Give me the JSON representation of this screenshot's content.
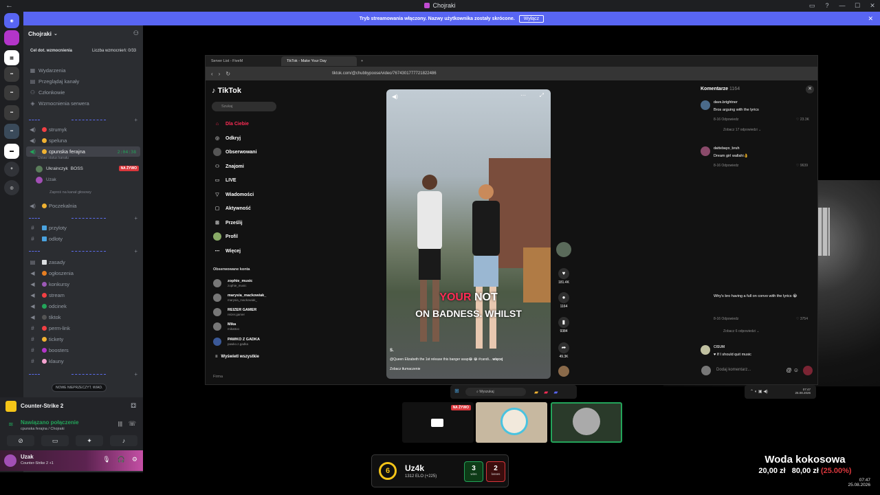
{
  "window": {
    "title": "Chojraki",
    "back": "←",
    "controls": [
      "▭",
      "?",
      "—",
      "☐",
      "✕"
    ]
  },
  "banner": {
    "text": "Tryb streamowania włączony. Nazwy użytkownika zostały skrócone.",
    "button": "Wyłącz",
    "close": "✕"
  },
  "server": {
    "name": "Chojraki",
    "boost_goal": "Cel dot. wzmocnienia",
    "boost_count": "Liczba wzmocnień: 0/33",
    "nav": [
      "Wydarzenia",
      "Przeglądaj kanały",
      "Członkowie",
      "Wzmocnienia serwera"
    ]
  },
  "channels": {
    "voice1": "strumyk",
    "voice2": "speluna",
    "voice3": "cpunska ferajna",
    "voice3_timer": "2:04:38",
    "voice3_status": "Ustaw status kanału",
    "member1": "Ukrainczyk",
    "member1_tag": "BOSS",
    "live": "NA ŻYWO",
    "member2": "Uzak",
    "invite": "Zaproś na kanał głosowy",
    "waiting": "Poczekalnia",
    "text1": "przyloty",
    "text2": "odloty",
    "info": [
      "zasady",
      "ogłoszenia",
      "konkursy",
      "stream",
      "odcinek",
      "tiktok",
      "perm-link",
      "tickety",
      "boosters",
      "klauny"
    ],
    "tooltip": "NOWE NIEPRZECZYT. WIAD."
  },
  "voice_panel": {
    "game": "Counter-Strike 2",
    "connected": "Nawiązano połączenie",
    "channel": "cpunska ferajna / Chojraki",
    "buttons": [
      "⊘",
      "▭",
      "✦",
      "♪"
    ]
  },
  "user_panel": {
    "name": "Uzak",
    "status": "Counter-Strike 2 +1",
    "controls": [
      "🎙",
      "🎧",
      "⚙"
    ]
  },
  "browser": {
    "tabs": [
      "Server List - FiveM",
      "TikTok - Make Your Day"
    ],
    "url": "tiktok.com/@chubbypoose/video/7674301777721822486"
  },
  "tiktok": {
    "logo": "TikTok",
    "search": "Szukaj",
    "nav": [
      "Dla Ciebie",
      "Odkryj",
      "Obserwowani",
      "Znajomi",
      "LIVE",
      "Wiadomości",
      "Aktywność",
      "Prześlij",
      "Profil",
      "Więcej"
    ],
    "followed_header": "Obserwowane konta",
    "accounts": [
      {
        "name": "zophie_music",
        "handle": "zophie_music"
      },
      {
        "name": "marysia_mackowiak_",
        "handle": "marysia_mackowiak_"
      },
      {
        "name": "REIZER GAMER",
        "handle": "reizer.gamer"
      },
      {
        "name": "Mika",
        "handle": "mikattoo"
      },
      {
        "name": "PAWKO Z GADKA",
        "handle": "pawko.z.gadka"
      }
    ],
    "show_all": "Wyświetl wszystkie",
    "company": "Firma",
    "caption_red": "YOUR",
    "caption_white": "NOT",
    "caption_line2": "ON BADNESS. WHILST",
    "video_user": "S.",
    "video_desc": "@Queen Elizabeth the 1st release this banger asap😂 😂 #candi...",
    "video_more": "więcej",
    "translation": "Zobacz tłumaczenie",
    "likes": "181.4K",
    "comments": "1164",
    "saves": "9384",
    "shares": "49.3K"
  },
  "comments": {
    "title": "Komentarze",
    "count": "1164",
    "items": [
      {
        "user": "dave.brightner",
        "text": "Bros arguing with the lyrics",
        "meta": "8-16   Odpowiedz",
        "likes": "♡ 23.3K",
        "more": "Zobacz 17 odpowiedzi ⌄"
      },
      {
        "user": "dattebayo_bruh",
        "text": "Dream girl wallahi👌",
        "meta": "8-16   Odpowiedz",
        "likes": "♡ 9639"
      },
      {
        "user": "",
        "text": "Why's bro having a full on convo with the lyrics 😭",
        "meta": "8-16   Odpowiedz",
        "likes": "♡ 3754",
        "more": "Zobacz 6 odpowiedzi ⌄"
      },
      {
        "user": "CISUM",
        "text": "♥ If I should quit music"
      }
    ],
    "input": "Dodaj komentarz..."
  },
  "taskbar": {
    "search": "Wyszukaj",
    "time": "07:47",
    "date": "25.08.2026"
  },
  "cs": {
    "level": "6",
    "name": "Uz4k",
    "elo": "1312 ELO (+225)",
    "wins": "3",
    "wins_label": "wins",
    "losses": "2",
    "losses_label": "losses"
  },
  "product": {
    "name": "Woda kokosowa",
    "new_price": "20,00 zł",
    "old_price": "80,00 zł",
    "discount": "(25.00%)"
  },
  "clock": {
    "time": "07:47",
    "date": "25.08.2026"
  },
  "colors": {
    "accent": "#5865f2",
    "live": "#da373c",
    "tiktok_red": "#fe2c55",
    "online": "#23a55a"
  }
}
